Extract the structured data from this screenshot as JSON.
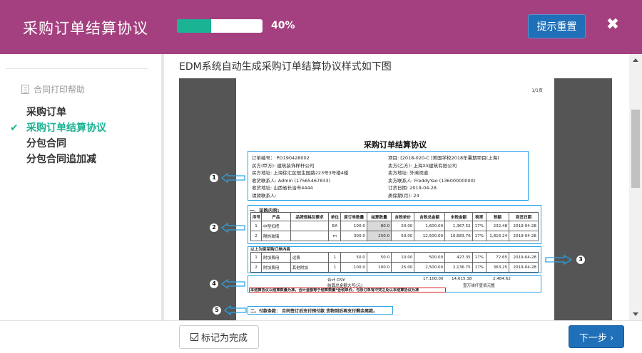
{
  "header": {
    "title": "采购订单结算协议",
    "progress_percent": 40,
    "progress_label": "40%",
    "reset_label": "提示重置",
    "close_icon": "close-icon",
    "colors": {
      "bar": "#a4407f",
      "accent": "#1ab394",
      "button": "#1f70b8"
    }
  },
  "sidebar": {
    "help_label": "合同打印帮助",
    "items": [
      {
        "label": "采购订单",
        "active": false
      },
      {
        "label": "采购订单结算协议",
        "active": true
      },
      {
        "label": "分包合同",
        "active": false
      },
      {
        "label": "分包合同追加减",
        "active": false
      }
    ]
  },
  "content": {
    "heading": "EDM系统自动生成采购订单结算协议样式如下图",
    "document": {
      "page_label": "1/1页",
      "title": "采购订单结算协议",
      "info": [
        [
          "订单编号：  PO190428002",
          "项目: [2018-020-C ]美国学校2018年暑期项目(上海)"
        ],
        [
          "买方(甲方): 建筑装饰样杆公司",
          "卖方(乙方): 上海XX建筑有限公司"
        ],
        [
          "买方地址: 上海徐汇区冠生园路223号3号楼4楼",
          "卖方地址: 外滩闵道"
        ],
        [
          "收货联系人: Admin (17565467833)",
          "卖方联系人: FreddyYao (13600000000)"
        ],
        [
          "收货地址: 山西省长治市4444",
          "订货日期: 2019-04-28"
        ],
        [
          "请款联系人:",
          "质保期(月): 24"
        ]
      ],
      "section1": "一、采购内容:",
      "columns": [
        "序号",
        "产品",
        "品牌规格及要求",
        "单位",
        "原订单数量",
        "结算数量",
        "含税单价",
        "含税总金额",
        "未税金额",
        "税率",
        "税额",
        "到货日期"
      ],
      "rows": [
        [
          "1",
          "中型扣把",
          "",
          "EA",
          "100.0",
          "80.0",
          "20.00",
          "1,600.00",
          "1,367.52",
          "17%",
          "232.48",
          "2019-04-28"
        ],
        [
          "2",
          "隔热玻璃",
          "",
          "m",
          "300.0",
          "250.0",
          "50.00",
          "12,500.00",
          "10,683.76",
          "17%",
          "1,816.24",
          "2019-04-28"
        ]
      ],
      "section_extra": "以上为原采购订单内容",
      "extra_rows": [
        [
          "1",
          "附加费用",
          "运费",
          "1",
          "50.0",
          "50.0",
          "10.00",
          "500.00",
          "427.35",
          "17%",
          "72.65",
          "2019-04-28"
        ],
        [
          "2",
          "附加费用",
          "其他附加",
          "1",
          "100.0",
          "100.0",
          "25.00",
          "2,500.00",
          "2,136.75",
          "17%",
          "363.25",
          "2019-04-28"
        ]
      ],
      "total_label": "合计 CNY:",
      "total_incl": "17,100.00",
      "total_excl": "14,615.38",
      "total_tax": "2,484.62",
      "amount_words_label": "结算总金额大写(元)",
      "amount_words": "壹万柒仟壹佰元整",
      "red_note": "本结算协议以结算数量为准，合计金额等于结算数量*含税单价，与原订单有冲突之处以本结算协议为准",
      "section2": "二、付款条款：  合同签订后支付预付款 货物到后再支付剩余尾款。"
    },
    "markers": [
      "1",
      "2",
      "3",
      "4",
      "5"
    ]
  },
  "footer": {
    "mark_done_label": "标记为完成",
    "next_label": "下一步",
    "next_icon": "chevron-right-icon"
  }
}
